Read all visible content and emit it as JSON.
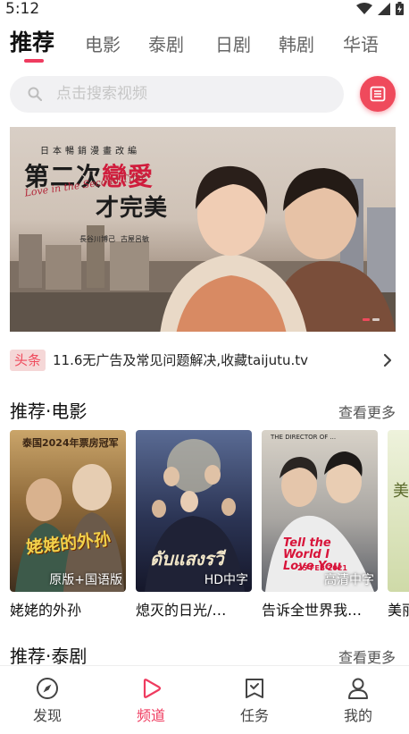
{
  "status_bar": {
    "time": "5:12"
  },
  "tabs": [
    {
      "label": "推荐",
      "active": true
    },
    {
      "label": "电影"
    },
    {
      "label": "泰剧"
    },
    {
      "label": "日剧"
    },
    {
      "label": "韩剧"
    },
    {
      "label": "华语"
    }
  ],
  "search": {
    "placeholder": "点击搜索视频"
  },
  "banner": {
    "subtitle": "日本暢銷漫畫改編",
    "title_part1": "第二次",
    "title_part2": "戀愛",
    "title_line2": "才完美",
    "english": "Love in the Second Time",
    "credit_left": "長谷川博己",
    "credit_right": "古屋呂敏",
    "slide_count": 2,
    "active_slide": 1
  },
  "notice": {
    "tag": "头条",
    "text": "11.6无广告及常见问题解决,收藏taijutu.tv"
  },
  "sections": [
    {
      "title": "推荐·电影",
      "more": "查看更多",
      "items": [
        {
          "title": "姥姥的外孙",
          "badge": "原版+国语版",
          "poster_text": "泰国2024年票房冠军",
          "poster_logo": "姥姥的外孙",
          "colors": [
            "#b58a4a",
            "#4a3a22"
          ]
        },
        {
          "title": "熄灭的日光/…",
          "badge": "HD中字",
          "poster_logo": "ดับแสงรวี",
          "colors": [
            "#3a4a78",
            "#1c1f33"
          ]
        },
        {
          "title": "告诉全世界我…",
          "badge": "高清中字",
          "poster_text": "THE DIRECTOR OF ...",
          "poster_logo": "Tell the World I Love You",
          "poster_date": "25 FEB 2021",
          "colors": [
            "#c9c2b8",
            "#6b6e74"
          ]
        },
        {
          "title": "美丽",
          "badge": "",
          "poster_logo": "美",
          "colors": [
            "#dfe8c8",
            "#b7c68f"
          ]
        }
      ]
    },
    {
      "title": "推荐·泰剧",
      "more": "查看更多"
    }
  ],
  "bottom_nav": [
    {
      "label": "发现",
      "icon": "compass-icon"
    },
    {
      "label": "频道",
      "icon": "play-icon",
      "active": true
    },
    {
      "label": "任务",
      "icon": "task-icon"
    },
    {
      "label": "我的",
      "icon": "user-icon"
    }
  ],
  "colors": {
    "accent": "#ef3b5f",
    "notice_tag_bg": "#f5d7d7"
  }
}
